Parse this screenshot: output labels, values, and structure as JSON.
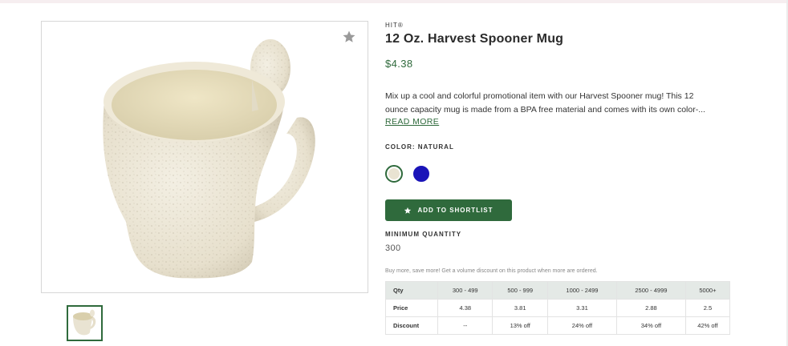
{
  "product": {
    "brand": "HIT®",
    "title": "12 Oz. Harvest Spooner Mug",
    "price": "$4.38",
    "description_line1": "Mix up a cool and colorful promotional item with our Harvest Spooner mug! This 12",
    "description_line2": "ounce capacity mug is made from a BPA free material and comes with its own color-...",
    "read_more": "READ MORE",
    "color_label": "COLOR: NATURAL",
    "colors": [
      {
        "name": "Natural",
        "hex": "#e9e3d2",
        "selected": true
      },
      {
        "name": "Blue",
        "hex": "#1a14b8",
        "selected": false
      }
    ],
    "shortlist_button": "ADD TO SHORTLIST",
    "min_quantity_label": "MINIMUM QUANTITY",
    "min_quantity_value": "300",
    "volume_note": "Buy more, save more! Get a volume discount on this product when more are ordered."
  },
  "pricing_table": {
    "headers": [
      "Qty",
      "300 - 499",
      "500 - 999",
      "1000 - 2499",
      "2500 - 4999",
      "5000+"
    ],
    "price_row": [
      "Price",
      "4.38",
      "3.81",
      "3.31",
      "2.88",
      "2.5"
    ],
    "discount_row": [
      "Discount",
      "--",
      "13% off",
      "24% off",
      "34% off",
      "42% off"
    ]
  },
  "icons": {
    "favorite": "star-icon",
    "button": "star-icon"
  },
  "colors": {
    "accent": "#2f6a3c",
    "table_header": "#e4e9e6"
  }
}
